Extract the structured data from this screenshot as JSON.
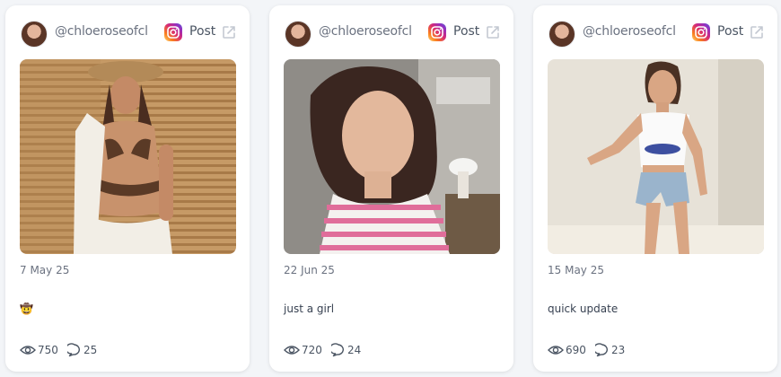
{
  "posts": [
    {
      "handle": "@chloeroseofcl",
      "platform_icon": "instagram-icon",
      "post_label": "Post",
      "date": "7 May 25",
      "caption": "🤠",
      "views": "750",
      "comments": "25"
    },
    {
      "handle": "@chloeroseofcl",
      "platform_icon": "instagram-icon",
      "post_label": "Post",
      "date": "22 Jun 25",
      "caption": "just a girl",
      "views": "720",
      "comments": "24"
    },
    {
      "handle": "@chloeroseofcl",
      "platform_icon": "instagram-icon",
      "post_label": "Post",
      "date": "15 May 25",
      "caption": "quick update",
      "views": "690",
      "comments": "23"
    }
  ],
  "colors": {
    "background": "#f3f5f8",
    "card": "#ffffff",
    "muted_text": "#6b7280",
    "instagram_gradient": [
      "#feda75",
      "#fa7e1e",
      "#d62976",
      "#962fbf",
      "#4f5bd5"
    ]
  }
}
